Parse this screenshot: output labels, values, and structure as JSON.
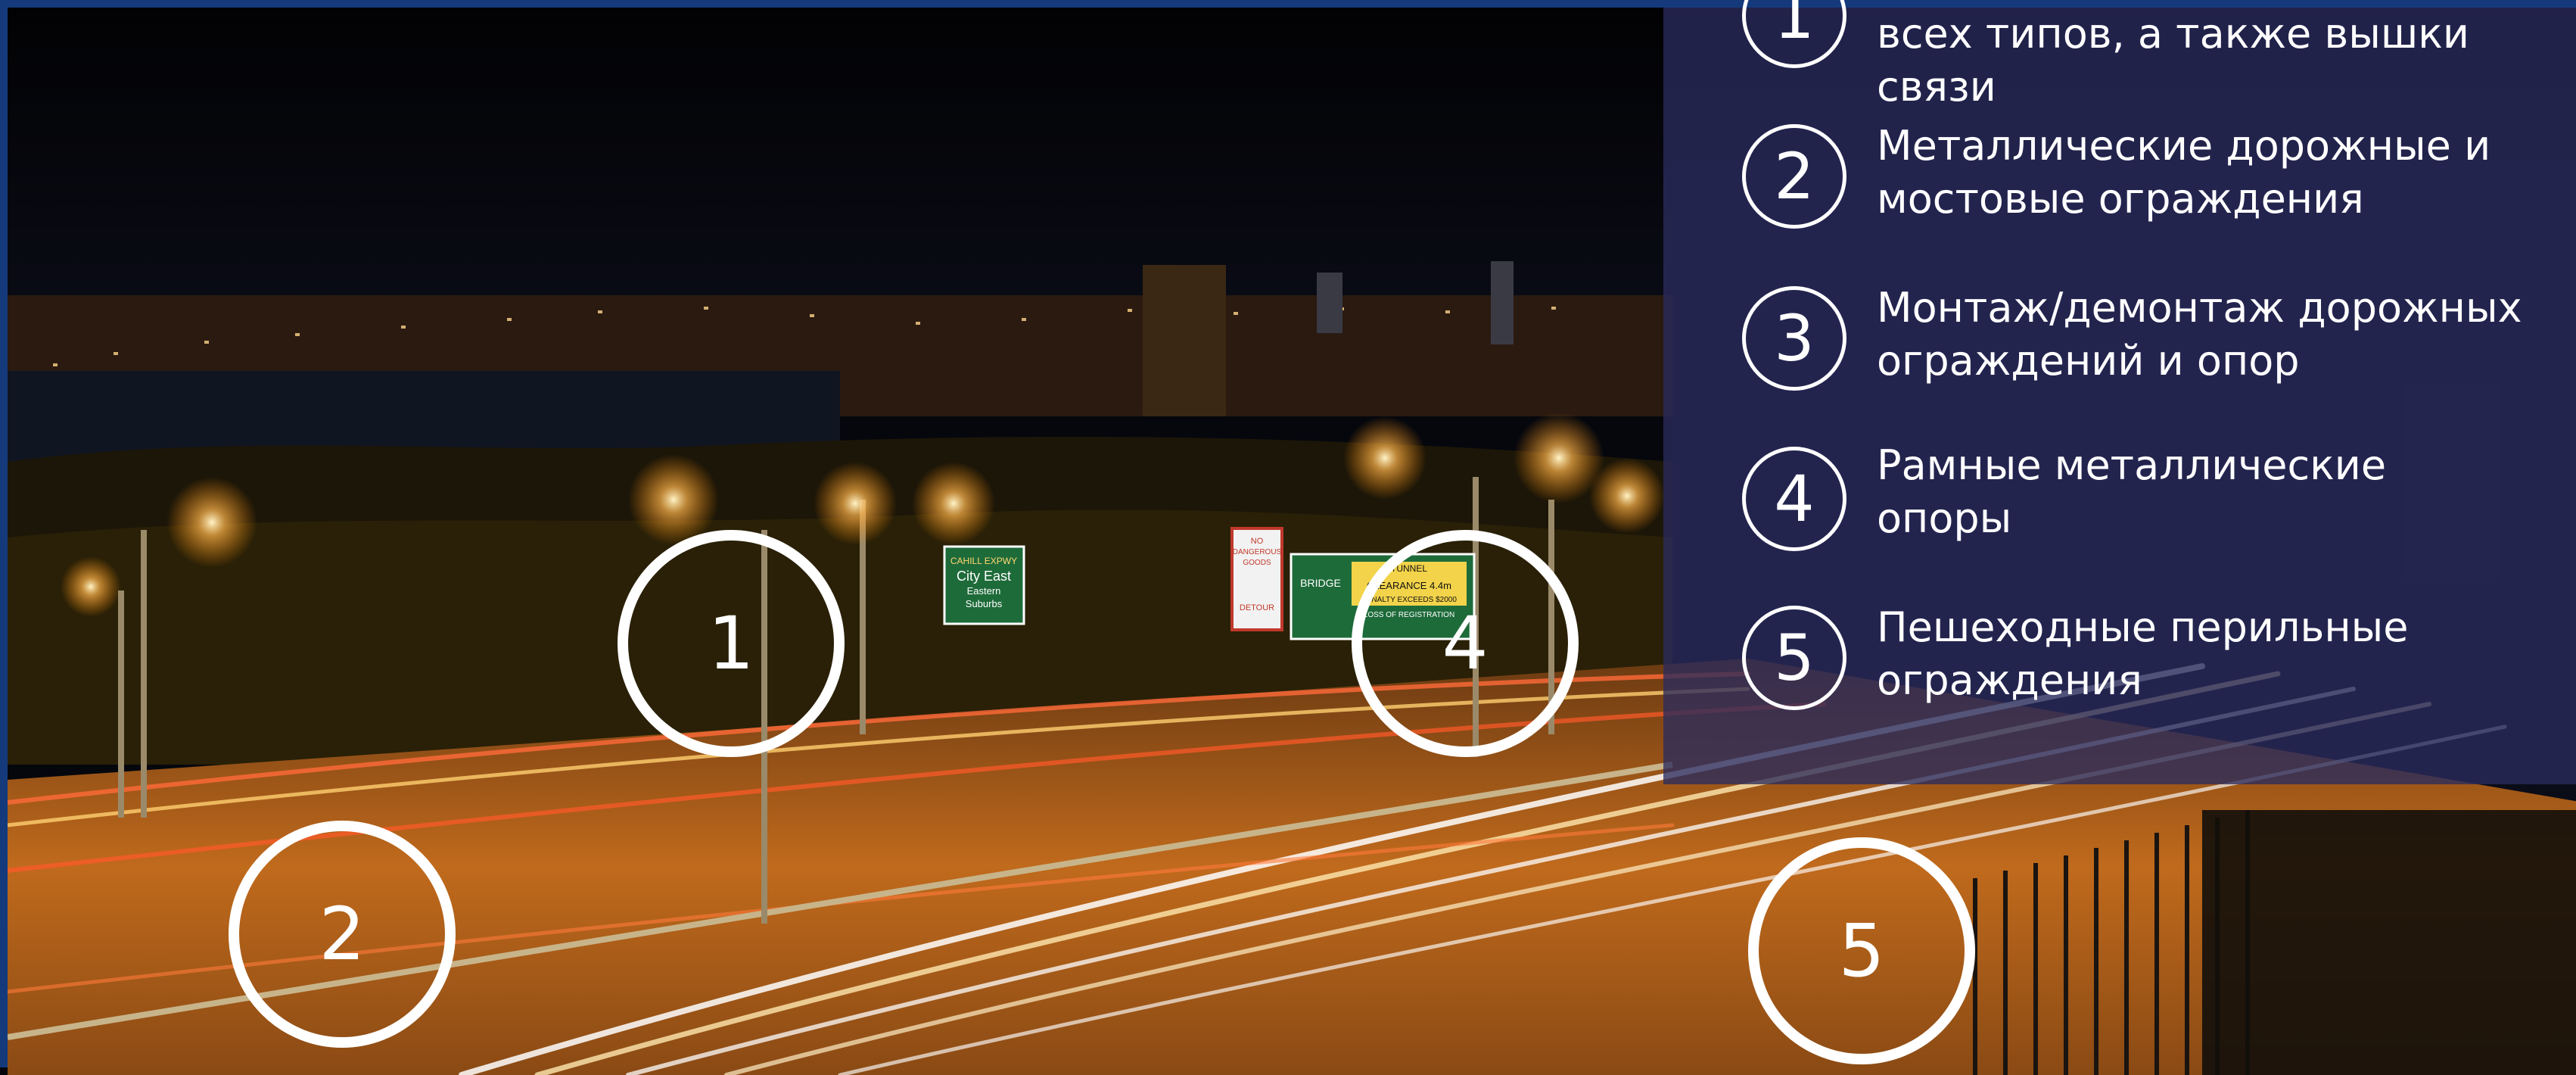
{
  "legend": {
    "items": [
      {
        "number": "1",
        "text_line1": "",
        "text_line2": "всех типов, а также вышки связи"
      },
      {
        "number": "2",
        "text_line1": "Металлические дорожные и",
        "text_line2": "мостовые ограждения"
      },
      {
        "number": "3",
        "text_line1": "Монтаж/демонтаж дорожных",
        "text_line2": "ограждений и опор"
      },
      {
        "number": "4",
        "text_line1": "Рамные металлические",
        "text_line2": "опоры"
      },
      {
        "number": "5",
        "text_line1": "Пешеходные перильные",
        "text_line2": "ограждения"
      }
    ]
  },
  "markers": [
    {
      "number": "1"
    },
    {
      "number": "2"
    },
    {
      "number": "4"
    },
    {
      "number": "5"
    }
  ],
  "signs": {
    "city_east": {
      "line1": "CAHILL EXPWY",
      "line2": "City East",
      "line3": "Eastern",
      "line4": "Suburbs"
    },
    "bridge": {
      "line1": "BRIDGE",
      "line2": "TUNNEL",
      "line3": "CLEARANCE 4.4m",
      "line4": "PENALTY EXCEEDS $2000",
      "line5": "LOSS OF REGISTRATION"
    },
    "warning": {
      "line1": "NO",
      "line2": "DANGEROUS",
      "line3": "GOODS",
      "line4": "DETOUR"
    }
  },
  "colors": {
    "border": "#143a7c",
    "panel": "#2a2c5e",
    "road_light": "#f5a623",
    "sign_green": "#1e6b3a"
  }
}
